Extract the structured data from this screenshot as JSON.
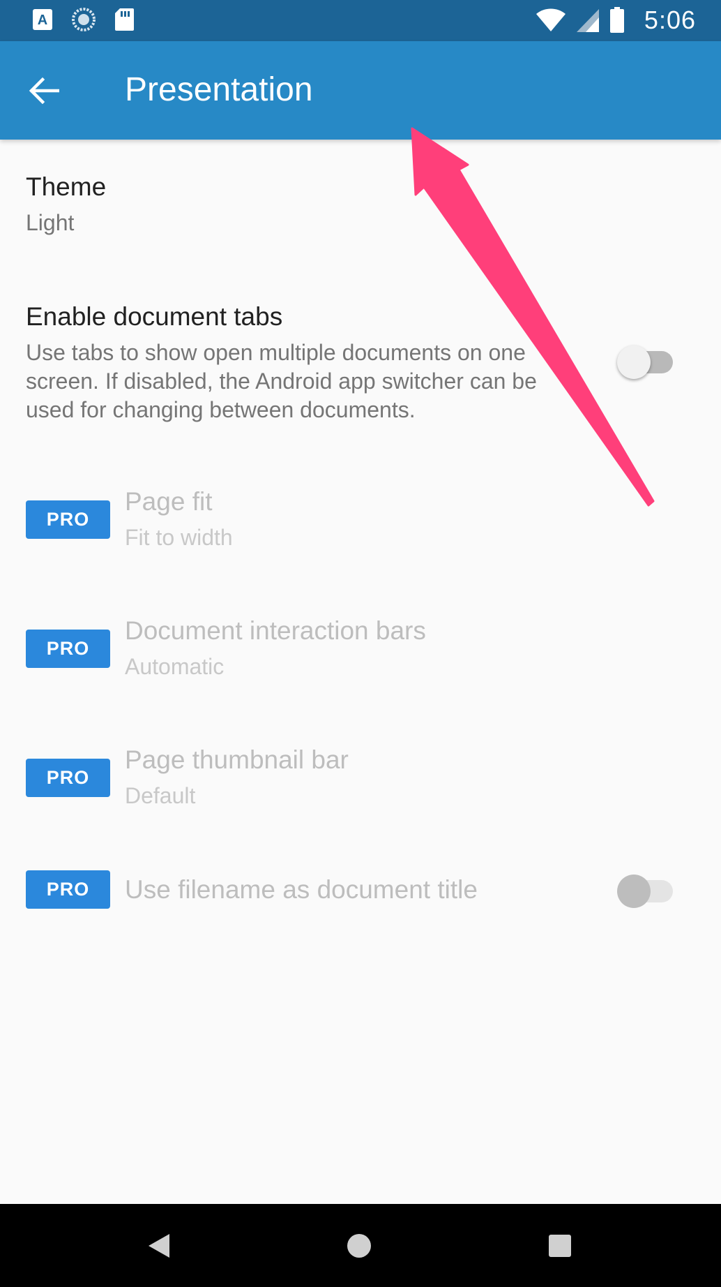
{
  "status_bar": {
    "time": "5:06",
    "icons_left": [
      "font-a-icon",
      "sync-progress-icon",
      "sd-card-icon"
    ],
    "icons_right": [
      "wifi-icon",
      "signal-icon",
      "battery-icon"
    ]
  },
  "app_bar": {
    "title": "Presentation",
    "back_icon": "arrow-back-icon"
  },
  "preferences": {
    "theme": {
      "title": "Theme",
      "summary": "Light"
    },
    "document_tabs": {
      "title": "Enable document tabs",
      "summary": "Use tabs to show open multiple documents on one screen. If disabled, the Android app switcher can be used for changing between documents.",
      "checked": false
    },
    "page_fit": {
      "badge": "PRO",
      "title": "Page fit",
      "summary": "Fit to width"
    },
    "interaction_bars": {
      "badge": "PRO",
      "title": "Document interaction bars",
      "summary": "Automatic"
    },
    "thumbnail_bar": {
      "badge": "PRO",
      "title": "Page thumbnail bar",
      "summary": "Default"
    },
    "filename_title": {
      "badge": "PRO",
      "title": "Use filename as document title",
      "checked": false
    }
  },
  "colors": {
    "status_bar": "#1c6496",
    "app_bar": "#2789c6",
    "pro_badge": "#2b88dc",
    "annotation_arrow": "#ff3f7a"
  },
  "nav_bar": {
    "icons": [
      "back-triangle-icon",
      "home-circle-icon",
      "recents-square-icon"
    ]
  }
}
